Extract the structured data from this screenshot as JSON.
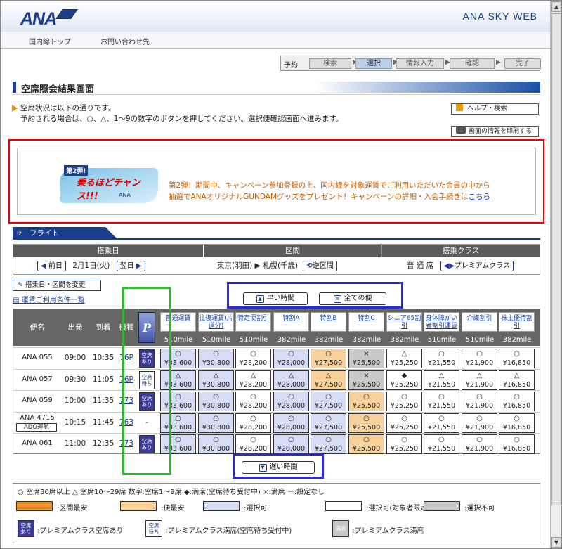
{
  "header": {
    "logo": "ANA",
    "site": "ANA SKY WEB"
  },
  "nav": {
    "domestic_top": "国内線トップ",
    "contact": "お問い合わせ先"
  },
  "steps": {
    "label": "予約",
    "items": [
      "検索",
      "選択",
      "情報入力",
      "確認",
      "完了"
    ],
    "active": 1
  },
  "page_title": "空席照会結果画面",
  "intro": {
    "line1": "空席状況は以下の通りです。",
    "line2": "予約される場合は、○、△、1～9の数字のボタンを押してください。選択便確認画面へ進みます。"
  },
  "help_button": "ヘルプ・検索",
  "print_button": "画面の情報を印刷する",
  "campaign": {
    "badge": "第2弾!",
    "headline": "乗るほどチャンス!!!",
    "logo": "ANA",
    "text1": "第2弾！期間中、キャンペーン参加登録の上、国内線を対象運賃でご利用いただいた会員の中から",
    "text2": "抽選でANAオリジナルGUNDAMグッズをプレゼント！キャンペーンの詳細・入会手続きは",
    "link": "こちら"
  },
  "flight_tab": "フライト",
  "conditions": {
    "date_header": "搭乗日",
    "route_header": "区間",
    "class_header": "搭乗クラス",
    "prev": "前日",
    "date": "2月1日(火)",
    "next": "翌日",
    "route": "東京(羽田) ▶ 札幌(千歳)",
    "reverse": "逆区間",
    "class": "普 通 席",
    "premium": "プレミアムクラス"
  },
  "change_button": "搭乗日・区間を変更",
  "rules_link": "運賃ご利用条件一覧",
  "time_buttons": {
    "early": "早い時間",
    "all": "全ての便",
    "late": "遅い時間"
  },
  "columns": {
    "flight": "便名",
    "dep": "出発",
    "arr": "到着",
    "type": "機種"
  },
  "fares": [
    {
      "name": "普通運賃",
      "mile": "510mile"
    },
    {
      "name": "往復運賃(片道分)",
      "mile": "510mile"
    },
    {
      "name": "特定便割引",
      "mile": "510mile"
    },
    {
      "name": "特割A",
      "mile": "382mile"
    },
    {
      "name": "特割B",
      "mile": "382mile"
    },
    {
      "name": "特割C",
      "mile": "382mile"
    },
    {
      "name": "シニア65割引",
      "mile": "382mile"
    },
    {
      "name": "身体障がい者割引運賃",
      "mile": "510mile"
    },
    {
      "name": "介護割引",
      "mile": "510mile"
    },
    {
      "name": "株主優待割引",
      "mile": "382mile"
    }
  ],
  "flights": [
    {
      "no": "ANA 055",
      "code": "",
      "dep": "09:00",
      "arr": "10:35",
      "type": "76P",
      "premium": "空席あり",
      "pstate": "av",
      "seats": [
        [
          "○",
          "¥33,600",
          "s"
        ],
        [
          "○",
          "¥30,800",
          "s"
        ],
        [
          "○",
          "¥28,200",
          "w"
        ],
        [
          "○",
          "¥28,000",
          "s"
        ],
        [
          "○",
          "¥27,500",
          "b"
        ],
        [
          "×",
          "¥25,500",
          "n"
        ],
        [
          "△",
          "¥25,250",
          "w"
        ],
        [
          "○",
          "¥21,550",
          "w"
        ],
        [
          "○",
          "¥21,900",
          "w"
        ],
        [
          "○",
          "¥16,850",
          "w"
        ]
      ]
    },
    {
      "no": "ANA 057",
      "code": "",
      "dep": "09:30",
      "arr": "11:05",
      "type": "76P",
      "premium": "空席待ち",
      "pstate": "wt",
      "seats": [
        [
          "△",
          "¥33,600",
          "s"
        ],
        [
          "△",
          "¥30,800",
          "s"
        ],
        [
          "△",
          "¥28,200",
          "w"
        ],
        [
          "△",
          "¥28,000",
          "s"
        ],
        [
          "△",
          "¥27,500",
          "b"
        ],
        [
          "×",
          "¥25,500",
          "n"
        ],
        [
          "◆",
          "¥25,250",
          "w"
        ],
        [
          "△",
          "¥21,550",
          "w"
        ],
        [
          "△",
          "¥21,900",
          "w"
        ],
        [
          "△",
          "¥16,850",
          "w"
        ]
      ]
    },
    {
      "no": "ANA 059",
      "code": "",
      "dep": "10:00",
      "arr": "11:35",
      "type": "773",
      "premium": "空席あり",
      "pstate": "av",
      "seats": [
        [
          "○",
          "¥33,600",
          "s"
        ],
        [
          "○",
          "¥30,800",
          "s"
        ],
        [
          "○",
          "¥28,200",
          "w"
        ],
        [
          "○",
          "¥28,000",
          "s"
        ],
        [
          "○",
          "¥27,500",
          "s"
        ],
        [
          "○",
          "¥25,500",
          "b"
        ],
        [
          "○",
          "¥25,250",
          "w"
        ],
        [
          "○",
          "¥21,550",
          "w"
        ],
        [
          "○",
          "¥21,900",
          "w"
        ],
        [
          "○",
          "¥16,850",
          "w"
        ]
      ]
    },
    {
      "no": "ANA 4715",
      "code": "ADO運航",
      "dep": "10:15",
      "arr": "11:45",
      "type": "763",
      "premium": "-",
      "pstate": "none",
      "seats": [
        [
          "○",
          "¥33,600",
          "s"
        ],
        [
          "○",
          "¥30,800",
          "s"
        ],
        [
          "○",
          "¥28,200",
          "w"
        ],
        [
          "○",
          "¥28,000",
          "s"
        ],
        [
          "○",
          "¥27,500",
          "s"
        ],
        [
          "○",
          "¥25,500",
          "b"
        ],
        [
          "○",
          "¥25,250",
          "w"
        ],
        [
          "○",
          "¥21,550",
          "w"
        ],
        [
          "○",
          "¥21,900",
          "w"
        ],
        [
          "○",
          "¥16,850",
          "w"
        ]
      ]
    },
    {
      "no": "ANA 061",
      "code": "",
      "dep": "11:00",
      "arr": "12:35",
      "type": "773",
      "premium": "空席あり",
      "pstate": "av",
      "seats": [
        [
          "○",
          "¥33,600",
          "s"
        ],
        [
          "○",
          "¥30,800",
          "s"
        ],
        [
          "○",
          "¥28,200",
          "w"
        ],
        [
          "○",
          "¥28,000",
          "s"
        ],
        [
          "○",
          "¥27,500",
          "s"
        ],
        [
          "○",
          "¥25,500",
          "b"
        ],
        [
          "○",
          "¥25,250",
          "w"
        ],
        [
          "○",
          "¥21,550",
          "w"
        ],
        [
          "○",
          "¥21,900",
          "w"
        ],
        [
          "○",
          "¥16,850",
          "w"
        ]
      ]
    }
  ],
  "legend": {
    "line1": "○:空席30席以上 △:空席10～29席 数字:空席1～9席 ◆:満席(空席待ち受付中) ×:満席 ー:設定なし",
    "swatches": [
      {
        "label": ":区間最安",
        "color": "#e8902f"
      },
      {
        "label": ":便最安",
        "color": "#f8d29a"
      },
      {
        "label": ":選択可",
        "color": "#d6dcf6"
      },
      {
        "label": ":選択可(対象者限定)",
        "color": "#ffffff"
      },
      {
        "label": ":選択不可",
        "color": "#c8c8c8"
      }
    ],
    "premium": [
      {
        "icon": "空席あり",
        "label": ":プレミアムクラス空席あり"
      },
      {
        "icon": "空席待ち",
        "label": ":プレミアムクラス満席(空席待ち受付中)"
      },
      {
        "icon": "満席",
        "label": ":プレミアムクラス満席"
      }
    ]
  },
  "colors": {
    "brand": "#1a3e8c",
    "area_cheapest": "#e8902f",
    "flight_cheapest": "#f8d29a",
    "selectable": "#d6dcf6",
    "restricted": "#ffffff",
    "unavailable": "#c8c8c8",
    "premium_available": "#3a3a9a"
  }
}
